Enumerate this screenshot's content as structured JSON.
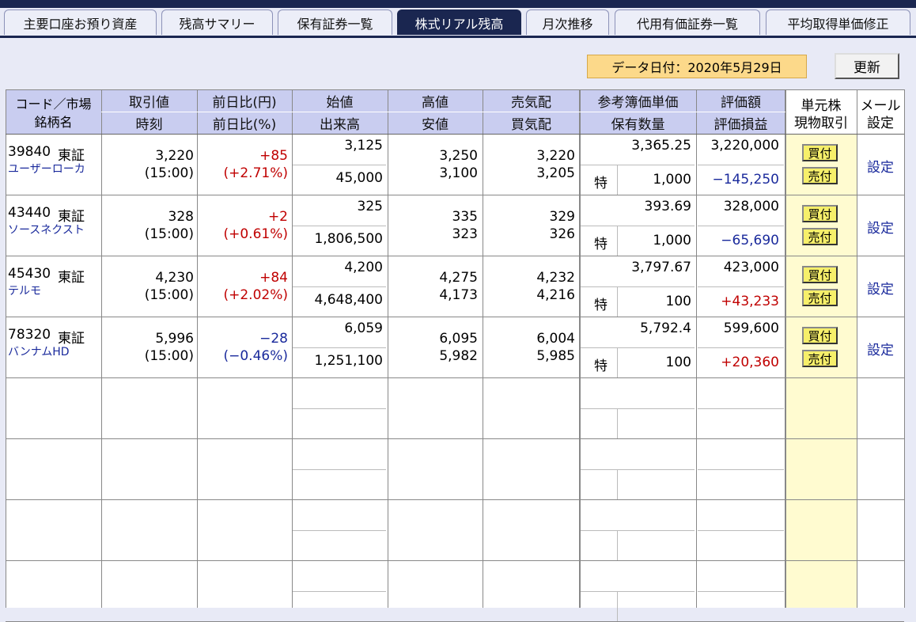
{
  "tabs": [
    {
      "label": "主要口座お預り資産"
    },
    {
      "label": "残高サマリー"
    },
    {
      "label": "保有証券一覧"
    },
    {
      "label": "株式リアル残高"
    },
    {
      "label": "月次推移"
    },
    {
      "label": "代用有価証券一覧"
    },
    {
      "label": "平均取得単価修正"
    }
  ],
  "toolbar": {
    "date_label": "データ日付：2020年5月29日",
    "refresh_label": "更新"
  },
  "header": {
    "code_market": "コード／市場",
    "name": "銘柄名",
    "price": "取引値",
    "time": "時刻",
    "change_yen": "前日比(円)",
    "change_pct": "前日比(%)",
    "open": "始値",
    "volume": "出来高",
    "high": "高値",
    "low": "安値",
    "ask": "売気配",
    "bid": "買気配",
    "book_price": "参考簿価単価",
    "quantity": "保有数量",
    "valuation": "評価額",
    "pnl": "評価損益",
    "unit_line1": "単元株",
    "unit_line2": "現物取引",
    "mail_line1": "メール",
    "mail_line2": "設定"
  },
  "rows": [
    {
      "code": "39840",
      "market": "東証",
      "name": "ユーザーローカ",
      "price": "3,220",
      "time": "(15:00)",
      "chg": "+85",
      "chg_pct": "(+2.71%)",
      "chg_dir": "up",
      "open": "3,125",
      "volume": "45,000",
      "high": "3,250",
      "low": "3,100",
      "ask": "3,220",
      "bid": "3,205",
      "book": "3,365.25",
      "acct": "特",
      "qty": "1,000",
      "val": "3,220,000",
      "pnl": "−145,250",
      "pnl_dir": "down"
    },
    {
      "code": "43440",
      "market": "東証",
      "name": "ソースネクスト",
      "price": "328",
      "time": "(15:00)",
      "chg": "+2",
      "chg_pct": "(+0.61%)",
      "chg_dir": "up",
      "open": "325",
      "volume": "1,806,500",
      "high": "335",
      "low": "323",
      "ask": "329",
      "bid": "326",
      "book": "393.69",
      "acct": "特",
      "qty": "1,000",
      "val": "328,000",
      "pnl": "−65,690",
      "pnl_dir": "down"
    },
    {
      "code": "45430",
      "market": "東証",
      "name": "テルモ",
      "price": "4,230",
      "time": "(15:00)",
      "chg": "+84",
      "chg_pct": "(+2.02%)",
      "chg_dir": "up",
      "open": "4,200",
      "volume": "4,648,400",
      "high": "4,275",
      "low": "4,173",
      "ask": "4,232",
      "bid": "4,216",
      "book": "3,797.67",
      "acct": "特",
      "qty": "100",
      "val": "423,000",
      "pnl": "+43,233",
      "pnl_dir": "up"
    },
    {
      "code": "78320",
      "market": "東証",
      "name": "バンナムHD",
      "price": "5,996",
      "time": "(15:00)",
      "chg": "−28",
      "chg_pct": "(−0.46%)",
      "chg_dir": "down",
      "open": "6,059",
      "volume": "1,251,100",
      "high": "6,095",
      "low": "5,982",
      "ask": "6,004",
      "bid": "5,985",
      "book": "5,792.4",
      "acct": "特",
      "qty": "100",
      "val": "599,600",
      "pnl": "+20,360",
      "pnl_dir": "up"
    }
  ],
  "actions": {
    "buy": "買付",
    "sell": "売付",
    "setting": "設定"
  },
  "colors": {
    "up": "#c00000",
    "down": "#1a2a9c",
    "header_bg": "#c9cdf0",
    "tab_active": "#1a2650",
    "trade_col": "#fffbd0"
  }
}
